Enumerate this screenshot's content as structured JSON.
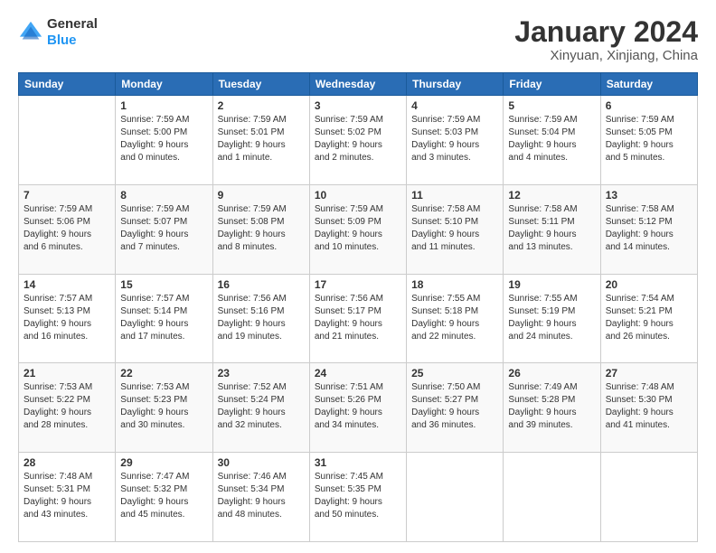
{
  "logo": {
    "line1": "General",
    "line2": "Blue"
  },
  "title": "January 2024",
  "subtitle": "Xinyuan, Xinjiang, China",
  "header": {
    "days": [
      "Sunday",
      "Monday",
      "Tuesday",
      "Wednesday",
      "Thursday",
      "Friday",
      "Saturday"
    ]
  },
  "weeks": [
    [
      {
        "day": "",
        "info": ""
      },
      {
        "day": "1",
        "info": "Sunrise: 7:59 AM\nSunset: 5:00 PM\nDaylight: 9 hours\nand 0 minutes."
      },
      {
        "day": "2",
        "info": "Sunrise: 7:59 AM\nSunset: 5:01 PM\nDaylight: 9 hours\nand 1 minute."
      },
      {
        "day": "3",
        "info": "Sunrise: 7:59 AM\nSunset: 5:02 PM\nDaylight: 9 hours\nand 2 minutes."
      },
      {
        "day": "4",
        "info": "Sunrise: 7:59 AM\nSunset: 5:03 PM\nDaylight: 9 hours\nand 3 minutes."
      },
      {
        "day": "5",
        "info": "Sunrise: 7:59 AM\nSunset: 5:04 PM\nDaylight: 9 hours\nand 4 minutes."
      },
      {
        "day": "6",
        "info": "Sunrise: 7:59 AM\nSunset: 5:05 PM\nDaylight: 9 hours\nand 5 minutes."
      }
    ],
    [
      {
        "day": "7",
        "info": "Sunrise: 7:59 AM\nSunset: 5:06 PM\nDaylight: 9 hours\nand 6 minutes."
      },
      {
        "day": "8",
        "info": "Sunrise: 7:59 AM\nSunset: 5:07 PM\nDaylight: 9 hours\nand 7 minutes."
      },
      {
        "day": "9",
        "info": "Sunrise: 7:59 AM\nSunset: 5:08 PM\nDaylight: 9 hours\nand 8 minutes."
      },
      {
        "day": "10",
        "info": "Sunrise: 7:59 AM\nSunset: 5:09 PM\nDaylight: 9 hours\nand 10 minutes."
      },
      {
        "day": "11",
        "info": "Sunrise: 7:58 AM\nSunset: 5:10 PM\nDaylight: 9 hours\nand 11 minutes."
      },
      {
        "day": "12",
        "info": "Sunrise: 7:58 AM\nSunset: 5:11 PM\nDaylight: 9 hours\nand 13 minutes."
      },
      {
        "day": "13",
        "info": "Sunrise: 7:58 AM\nSunset: 5:12 PM\nDaylight: 9 hours\nand 14 minutes."
      }
    ],
    [
      {
        "day": "14",
        "info": "Sunrise: 7:57 AM\nSunset: 5:13 PM\nDaylight: 9 hours\nand 16 minutes."
      },
      {
        "day": "15",
        "info": "Sunrise: 7:57 AM\nSunset: 5:14 PM\nDaylight: 9 hours\nand 17 minutes."
      },
      {
        "day": "16",
        "info": "Sunrise: 7:56 AM\nSunset: 5:16 PM\nDaylight: 9 hours\nand 19 minutes."
      },
      {
        "day": "17",
        "info": "Sunrise: 7:56 AM\nSunset: 5:17 PM\nDaylight: 9 hours\nand 21 minutes."
      },
      {
        "day": "18",
        "info": "Sunrise: 7:55 AM\nSunset: 5:18 PM\nDaylight: 9 hours\nand 22 minutes."
      },
      {
        "day": "19",
        "info": "Sunrise: 7:55 AM\nSunset: 5:19 PM\nDaylight: 9 hours\nand 24 minutes."
      },
      {
        "day": "20",
        "info": "Sunrise: 7:54 AM\nSunset: 5:21 PM\nDaylight: 9 hours\nand 26 minutes."
      }
    ],
    [
      {
        "day": "21",
        "info": "Sunrise: 7:53 AM\nSunset: 5:22 PM\nDaylight: 9 hours\nand 28 minutes."
      },
      {
        "day": "22",
        "info": "Sunrise: 7:53 AM\nSunset: 5:23 PM\nDaylight: 9 hours\nand 30 minutes."
      },
      {
        "day": "23",
        "info": "Sunrise: 7:52 AM\nSunset: 5:24 PM\nDaylight: 9 hours\nand 32 minutes."
      },
      {
        "day": "24",
        "info": "Sunrise: 7:51 AM\nSunset: 5:26 PM\nDaylight: 9 hours\nand 34 minutes."
      },
      {
        "day": "25",
        "info": "Sunrise: 7:50 AM\nSunset: 5:27 PM\nDaylight: 9 hours\nand 36 minutes."
      },
      {
        "day": "26",
        "info": "Sunrise: 7:49 AM\nSunset: 5:28 PM\nDaylight: 9 hours\nand 39 minutes."
      },
      {
        "day": "27",
        "info": "Sunrise: 7:48 AM\nSunset: 5:30 PM\nDaylight: 9 hours\nand 41 minutes."
      }
    ],
    [
      {
        "day": "28",
        "info": "Sunrise: 7:48 AM\nSunset: 5:31 PM\nDaylight: 9 hours\nand 43 minutes."
      },
      {
        "day": "29",
        "info": "Sunrise: 7:47 AM\nSunset: 5:32 PM\nDaylight: 9 hours\nand 45 minutes."
      },
      {
        "day": "30",
        "info": "Sunrise: 7:46 AM\nSunset: 5:34 PM\nDaylight: 9 hours\nand 48 minutes."
      },
      {
        "day": "31",
        "info": "Sunrise: 7:45 AM\nSunset: 5:35 PM\nDaylight: 9 hours\nand 50 minutes."
      },
      {
        "day": "",
        "info": ""
      },
      {
        "day": "",
        "info": ""
      },
      {
        "day": "",
        "info": ""
      }
    ]
  ]
}
